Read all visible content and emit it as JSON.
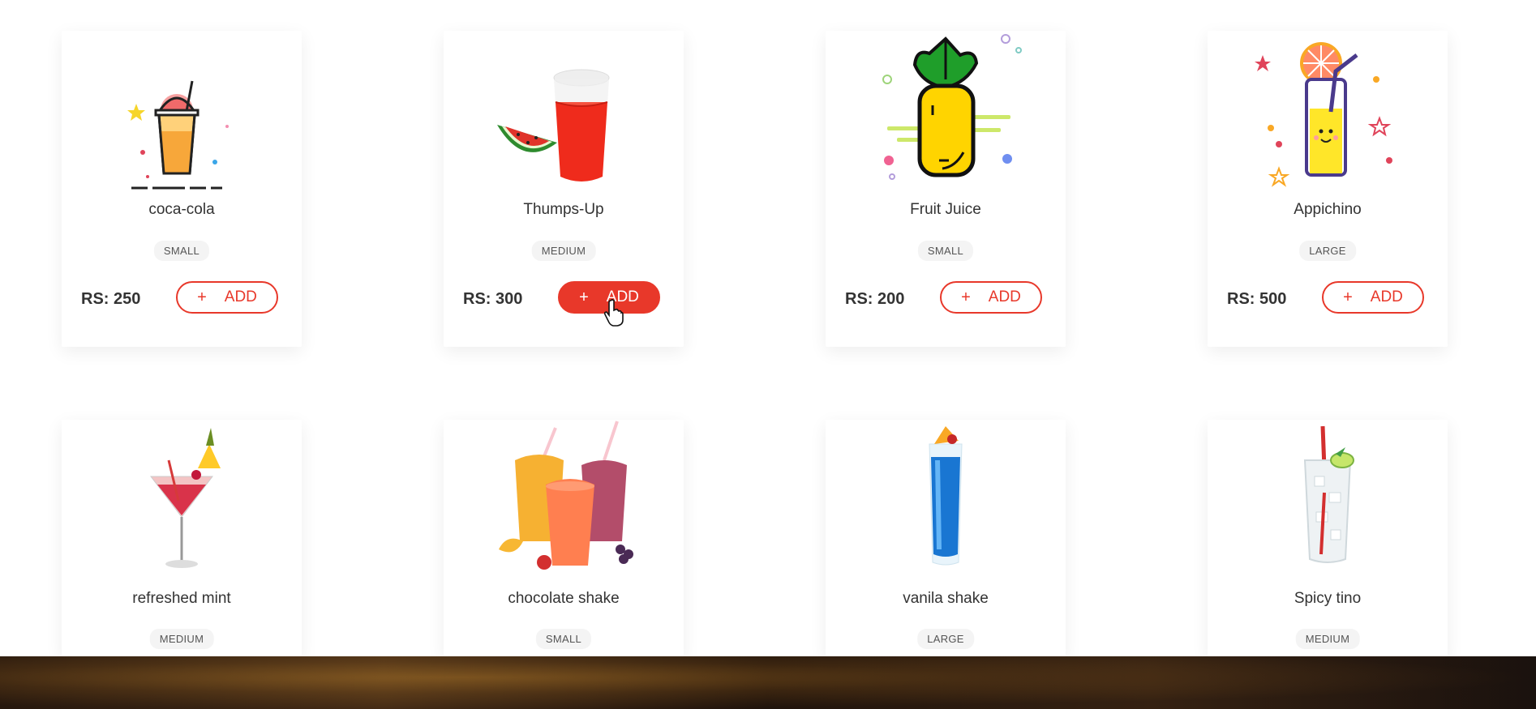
{
  "products": [
    {
      "name": "coca-cola",
      "size": "SMALL",
      "price": "RS: 250",
      "add_label": "ADD",
      "icon": "soda-cup-icon"
    },
    {
      "name": "Thumps-Up",
      "size": "MEDIUM",
      "price": "RS: 300",
      "add_label": "ADD",
      "icon": "watermelon-juice-icon"
    },
    {
      "name": "Fruit Juice",
      "size": "SMALL",
      "price": "RS: 200",
      "add_label": "ADD",
      "icon": "pineapple-icon"
    },
    {
      "name": "Appichino",
      "size": "LARGE",
      "price": "RS: 500",
      "add_label": "ADD",
      "icon": "lemonade-glass-icon"
    },
    {
      "name": "refreshed mint",
      "size": "MEDIUM",
      "icon": "cocktail-glass-icon"
    },
    {
      "name": "chocolate shake",
      "size": "SMALL",
      "icon": "smoothie-cups-icon"
    },
    {
      "name": "vanila shake",
      "size": "LARGE",
      "icon": "blue-drink-icon"
    },
    {
      "name": "Spicy tino",
      "size": "MEDIUM",
      "icon": "lime-soda-icon"
    }
  ],
  "add_plus": "+",
  "colors": {
    "accent": "#e8382a"
  }
}
